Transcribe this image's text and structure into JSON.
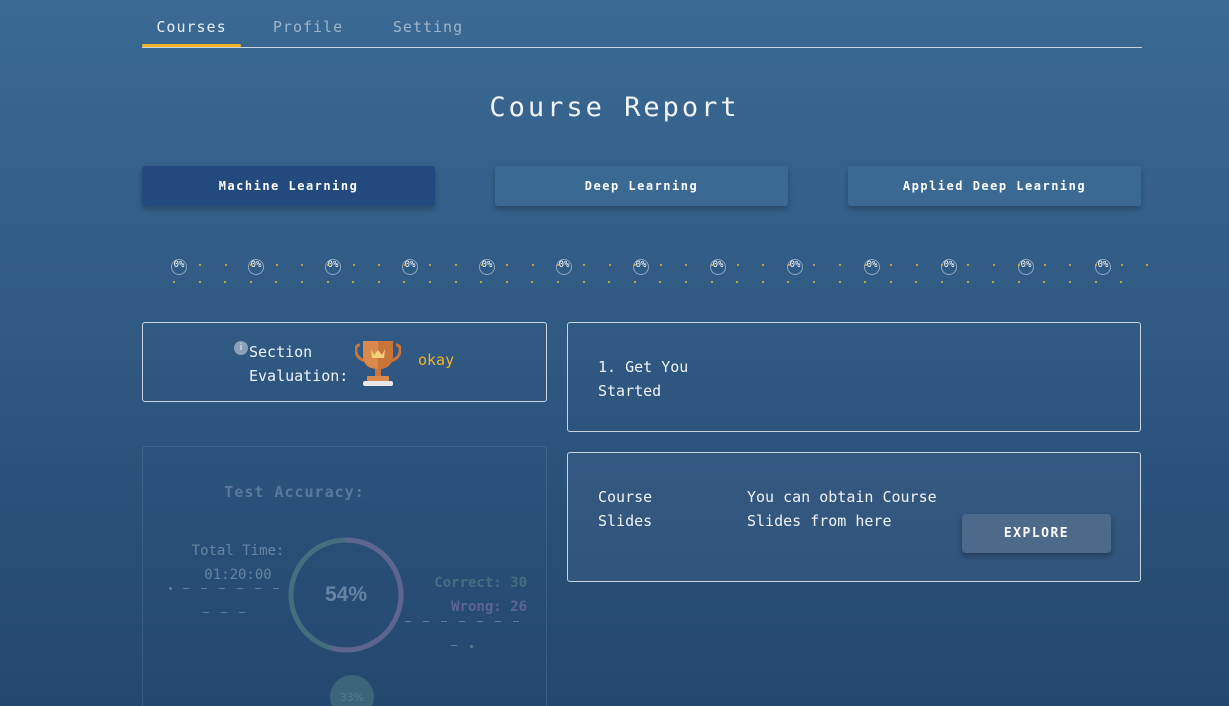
{
  "nav": {
    "tabs": [
      {
        "label": "Courses",
        "active": true
      },
      {
        "label": "Profile",
        "active": false
      },
      {
        "label": "Setting",
        "active": false
      }
    ]
  },
  "page": {
    "title": "Course Report"
  },
  "courses": [
    {
      "label": "Machine Learning",
      "active": true
    },
    {
      "label": "Deep Learning",
      "active": false
    },
    {
      "label": "Applied Deep Learning",
      "active": false
    }
  ],
  "progress": {
    "nodes": [
      "0%",
      "0%",
      "0%",
      "0%",
      "0%",
      "0%",
      "0%",
      "0%",
      "0%",
      "0%",
      "0%",
      "0%",
      "0%"
    ]
  },
  "evaluation": {
    "info_icon": "i",
    "label": "Section Evaluation:",
    "trophy_icon": "trophy-icon",
    "value": "okay"
  },
  "section": {
    "title": "1. Get You Started"
  },
  "slides": {
    "label": "Course Slides",
    "description": "You can obtain Course Slides from here",
    "button": "EXPLORE"
  },
  "test": {
    "title": "Test Accuracy:",
    "time_label": "Total Time:",
    "time_value": "01:20:00",
    "accuracy": "54%",
    "accuracy_fraction": 0.54,
    "correct_label": "Correct: 30",
    "wrong_label": "Wrong: 26",
    "small_percent": "33%"
  },
  "colors": {
    "accent": "#f0b322",
    "active_course": "#234a7e",
    "course": "#3a6a94",
    "correct": "#5c8a86",
    "wrong": "#8a7aa6"
  }
}
